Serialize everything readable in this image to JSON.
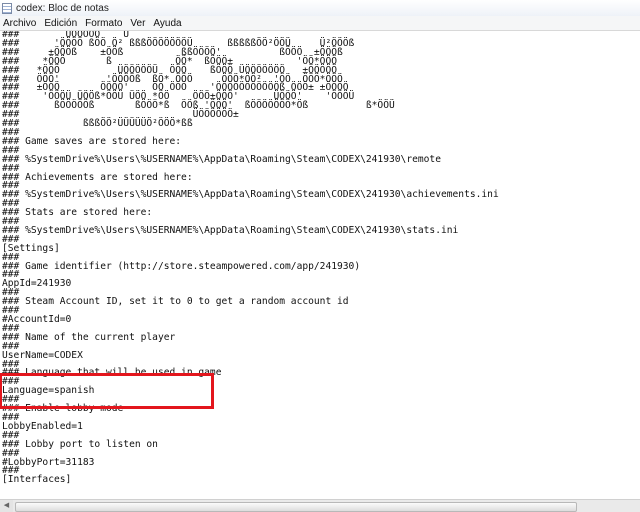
{
  "window": {
    "title": "codex: Bloc de notas"
  },
  "menu": [
    {
      "label": "Archivo"
    },
    {
      "label": "Edición"
    },
    {
      "label": "Formato"
    },
    {
      "label": "Ver"
    },
    {
      "label": "Ayuda"
    }
  ],
  "document": {
    "text": "###        ÜÖÖÖÖÖ    Ü\n###      'ÖÖÖÖ ßÖÖ Ö² ßßßÖÖÖÖÖÖÖÜ      ßßßßßÖÖ²ÖÖÜ     Ü²ÖÖÖß\n###     ±ÖÖÖß    ±ÖÖß          ßßÖÖÖÖ'          ßÖÖÖ  ±ÖÖÖß\n###    *ÖÖÖ       ß           ÖÖ*  ßÖÖÖ±           'ÖÖ*ÖÖÖ\n###   *ÖÖÖ          ÜÖÖÖÖÖÜ  ÖÖÖ    ßÖÖÖ ÜÖÖÖÖÖÖÖ   ±ÖÖÖÖÖ\n###   ÖÖÖ'        'ÖÖÖÖß  ßÖ* ÖÖÖ     ÖÖÖ*ÖÖ²  'ÖÖ  ÖÖÖ*ÖÖÖ\n###   ±ÖÖÖ       ÖÖÖÖ'    ÖÖ ÖÖÖ    'ÖÖÖÖÖÖÖÖÖÖÖß ÖÖÖ± ±ÖÖÖÖ\n###    'ÖÖÖÜ ÜÖÖß*ÖÖÜ ÜÖÖ *ÖÖ    ÖÖÖ±ÖÖÖ'      ÜÖÖÖ'    'ÖÖÖÜ\n###      ßÖÖÖÖÖß       ßÖÖÖ*ß  ÖÖß 'ÖÖÖ'  ßÖÖÖÖÖÖÖ*Öß          ß*ÖÖÜ\n###                              ÜÖÖÖÖÖÖ±\n###           ßßßÖÖ²ÜÜÜÜÜÖ²ÖÖÖ*ßß\n###\n### Game saves are stored here:\n###\n### %SystemDrive%\\Users\\%USERNAME%\\AppData\\Roaming\\Steam\\CODEX\\241930\\remote\n###\n### Achievements are stored here:\n###\n### %SystemDrive%\\Users\\%USERNAME%\\AppData\\Roaming\\Steam\\CODEX\\241930\\achievements.ini\n###\n### Stats are stored here:\n###\n### %SystemDrive%\\Users\\%USERNAME%\\AppData\\Roaming\\Steam\\CODEX\\241930\\stats.ini\n###\n[Settings]\n###\n### Game identifier (http://store.steampowered.com/app/241930)\n###\nAppId=241930\n###\n### Steam Account ID, set it to 0 to get a random account id\n###\n#AccountId=0\n###\n### Name of the current player\n###\nUserName=CODEX\n###\n### Language that will be used in game\n###\nLanguage=spanish\n###\n### Enable lobby mode\n###\nLobbyEnabled=1\n###\n### Lobby port to listen on\n###\n#LobbyPort=31183\n###\n[Interfaces]"
  },
  "colors": {
    "highlight_border": "#e3161d",
    "editor_background": "#ffffff",
    "menubar_background": "#f5f6f7"
  },
  "icons": {
    "app": "notepad-icon",
    "scroll_left": "scroll-left-arrow-icon"
  }
}
